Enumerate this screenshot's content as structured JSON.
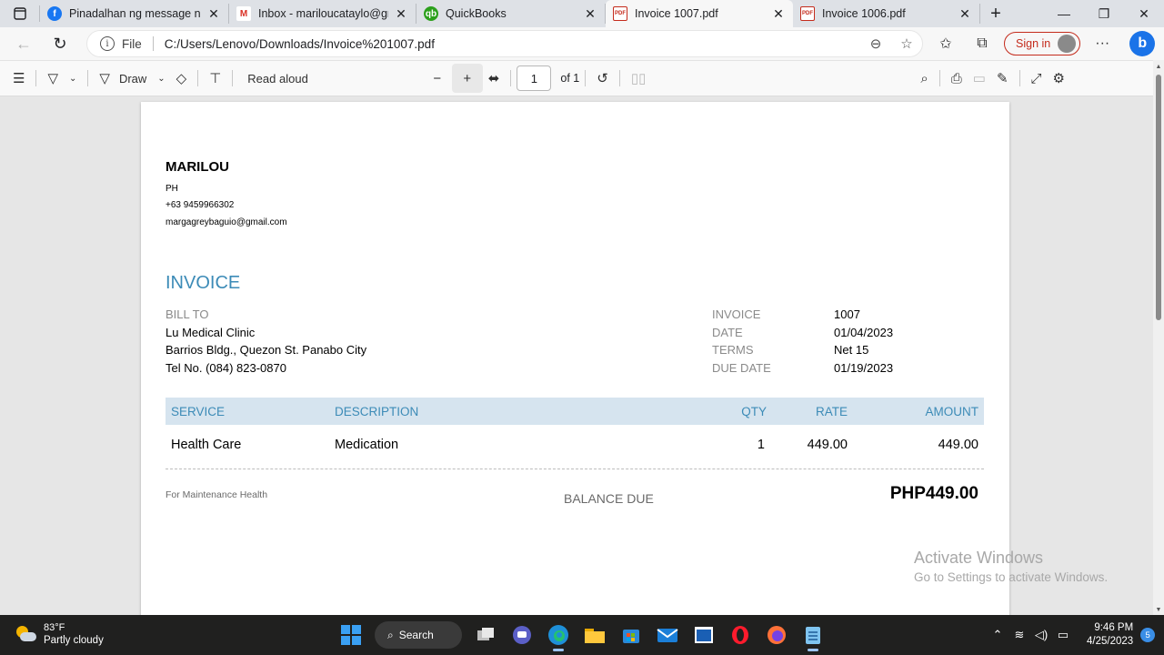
{
  "browser": {
    "tabs": [
      {
        "title": "Pinadalhan ng message ni Ab",
        "favicon": "facebook-icon",
        "active": false
      },
      {
        "title": "Inbox - mariloucataylo@gma",
        "favicon": "gmail-icon",
        "active": false
      },
      {
        "title": "QuickBooks",
        "favicon": "quickbooks-icon",
        "active": false
      },
      {
        "title": "Invoice 1007.pdf",
        "favicon": "pdf-icon",
        "active": true
      },
      {
        "title": "Invoice 1006.pdf",
        "favicon": "pdf-icon",
        "active": false
      }
    ],
    "address": {
      "scheme": "File",
      "url": "C:/Users/Lenovo/Downloads/Invoice%201007.pdf"
    },
    "signin_label": "Sign in"
  },
  "pdf_toolbar": {
    "draw_label": "Draw",
    "read_aloud_label": "Read aloud",
    "page_current": "1",
    "page_total": "of 1"
  },
  "invoice": {
    "company": "MARILOU",
    "country": "PH",
    "phone": "+63 9459966302",
    "email": "margagreybaguio@gmail.com",
    "title": "INVOICE",
    "bill_to_label": "BILL TO",
    "bill_to": [
      "Lu Medical Clinic",
      "Barrios Bldg., Quezon St. Panabo City",
      "Tel No. (084) 823-0870"
    ],
    "meta": [
      {
        "label": "INVOICE",
        "value": "1007"
      },
      {
        "label": "DATE",
        "value": "01/04/2023"
      },
      {
        "label": "TERMS",
        "value": "Net 15"
      },
      {
        "label": "DUE DATE",
        "value": "01/19/2023"
      }
    ],
    "columns": {
      "service": "SERVICE",
      "description": "DESCRIPTION",
      "qty": "QTY",
      "rate": "RATE",
      "amount": "AMOUNT"
    },
    "rows": [
      {
        "service": "Health Care",
        "description": "Medication",
        "qty": "1",
        "rate": "449.00",
        "amount": "449.00"
      }
    ],
    "note": "For Maintenance Health",
    "balance_label": "BALANCE DUE",
    "balance_total": "PHP449.00"
  },
  "watermark": {
    "line1": "Activate Windows",
    "line2": "Go to Settings to activate Windows."
  },
  "taskbar": {
    "temperature": "83°F",
    "weather": "Partly cloudy",
    "search_label": "Search",
    "time": "9:46 PM",
    "date": "4/25/2023",
    "notifications": "5"
  },
  "colors": {
    "accent": "#3c8bb7",
    "table_header_bg": "#d6e4ef",
    "signin": "#c42b1c"
  }
}
